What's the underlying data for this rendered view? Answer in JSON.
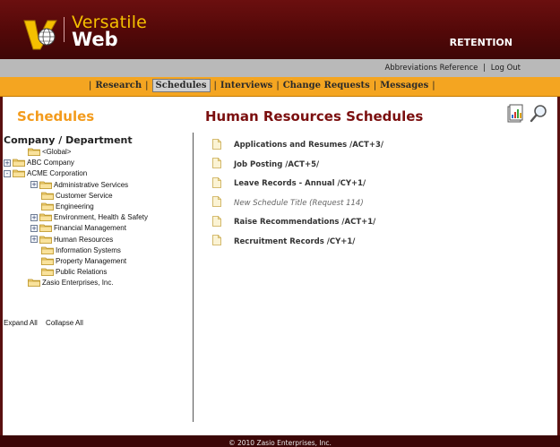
{
  "brand": {
    "line1": "Versatile",
    "line2": "Web",
    "module": "RETENTION"
  },
  "top_links": {
    "abbreviations": "Abbreviations Reference",
    "separator": "|",
    "logout": "Log Out"
  },
  "nav": {
    "leading_sep": "|",
    "items": [
      "Research",
      "Schedules",
      "Interviews",
      "Change Requests",
      "Messages"
    ],
    "active": "Schedules"
  },
  "left_panel": {
    "title": "Schedules",
    "tree_header": "Company / Department",
    "tree": [
      {
        "label": "<Global>",
        "level": 1,
        "toggle": ""
      },
      {
        "label": "ABC Company",
        "level": 0,
        "toggle": "+"
      },
      {
        "label": "ACME Corporation",
        "level": 0,
        "toggle": "-"
      },
      {
        "label": "Administrative Services",
        "level": 2,
        "toggle": "+"
      },
      {
        "label": "Customer Service",
        "level": 3,
        "toggle": ""
      },
      {
        "label": "Engineering",
        "level": 3,
        "toggle": ""
      },
      {
        "label": "Environment, Health & Safety",
        "level": 2,
        "toggle": "+"
      },
      {
        "label": "Financial Management",
        "level": 2,
        "toggle": "+"
      },
      {
        "label": "Human Resources",
        "level": 2,
        "toggle": "+"
      },
      {
        "label": "Information Systems",
        "level": 3,
        "toggle": ""
      },
      {
        "label": "Property Management",
        "level": 3,
        "toggle": ""
      },
      {
        "label": "Public Relations",
        "level": 3,
        "toggle": ""
      },
      {
        "label": "Zasio Enterprises, Inc.",
        "level": 1,
        "toggle": ""
      }
    ],
    "expand_all": "Expand All",
    "collapse_all": "Collapse All"
  },
  "main": {
    "title": "Human Resources Schedules",
    "schedules": [
      {
        "label": "Applications and Resumes  /ACT+3/",
        "style": "bold"
      },
      {
        "label": "Job Posting  /ACT+5/",
        "style": "bold"
      },
      {
        "label": "Leave Records - Annual  /CY+1/",
        "style": "bold"
      },
      {
        "label": "New Schedule Title (Request 114)",
        "style": "new"
      },
      {
        "label": "Raise Recommendations  /ACT+1/",
        "style": "bold"
      },
      {
        "label": "Recruitment Records  /CY+1/",
        "style": "bold"
      }
    ]
  },
  "footer": {
    "copyright": "© 2010 Zasio Enterprises, Inc."
  },
  "icons": {
    "report": "report-icon",
    "search": "search-icon",
    "folder": "folder-icon",
    "document": "document-icon"
  },
  "colors": {
    "header_bg": "#520808",
    "nav_bg": "#f4a521",
    "left_title": "#f39b1c",
    "main_title": "#7b0f0f",
    "logo_gold": "#f5c000"
  }
}
